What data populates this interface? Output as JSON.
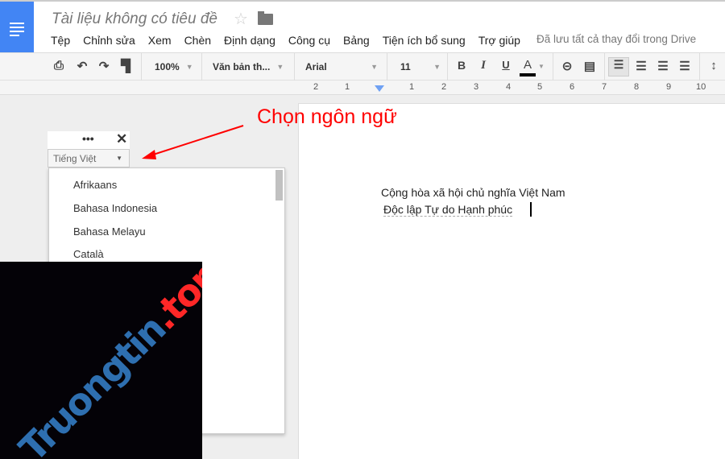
{
  "header": {
    "title": "Tài liệu không có tiêu đề",
    "saved_status": "Đã lưu tất cả thay đổi trong Drive",
    "menu": [
      "Tệp",
      "Chỉnh sửa",
      "Xem",
      "Chèn",
      "Định dạng",
      "Công cụ",
      "Bảng",
      "Tiện ích bổ sung",
      "Trợ giúp"
    ]
  },
  "toolbar": {
    "zoom": "100%",
    "style": "Văn bản th...",
    "font": "Arial",
    "size": "11",
    "font_color": "#000000"
  },
  "ruler": [
    "2",
    "1",
    "1",
    "2",
    "3",
    "4",
    "5",
    "6",
    "7",
    "8",
    "9",
    "10"
  ],
  "document": {
    "line1": "Cộng hòa xã hội chủ nghĩa Việt Nam",
    "line2": "Độc lập Tự do Hạnh phúc"
  },
  "annotation": "Chọn ngôn ngữ",
  "language_widget": {
    "selected": "Tiếng Việt",
    "options": [
      "Afrikaans",
      "Bahasa Indonesia",
      "Bahasa Melayu",
      "Català"
    ]
  },
  "watermark": {
    "text_main": "Truongtin",
    "text_tld": ".top"
  }
}
